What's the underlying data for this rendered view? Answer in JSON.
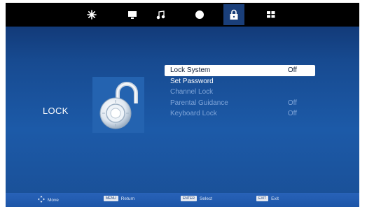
{
  "tabs": [
    {
      "name": "picture-icon",
      "active": false
    },
    {
      "name": "monitor-icon",
      "active": false
    },
    {
      "name": "music-icon",
      "active": false
    },
    {
      "name": "circle-icon",
      "active": false
    },
    {
      "name": "lock-icon",
      "active": true
    },
    {
      "name": "grid-icon",
      "active": false
    }
  ],
  "page": {
    "title": "LOCK"
  },
  "menu": {
    "items": [
      {
        "label": "Lock System",
        "value": "Off",
        "selected": true,
        "enabled": true
      },
      {
        "label": "Set Password",
        "value": "",
        "selected": false,
        "enabled": true
      },
      {
        "label": "Channel Lock",
        "value": "",
        "selected": false,
        "enabled": false
      },
      {
        "label": "Parental Guidance",
        "value": "Off",
        "selected": false,
        "enabled": false
      },
      {
        "label": "Keyboard Lock",
        "value": "Off",
        "selected": false,
        "enabled": false
      }
    ]
  },
  "hints": [
    {
      "key": "",
      "label": "Move"
    },
    {
      "key": "MENU",
      "label": "Return"
    },
    {
      "key": "ENTER",
      "label": "Select"
    },
    {
      "key": "EXIT",
      "label": "Exit"
    }
  ],
  "colors": {
    "background": "#1c5aa8",
    "selection": "#ffffff",
    "disabled_text": "#7ea4d8"
  }
}
